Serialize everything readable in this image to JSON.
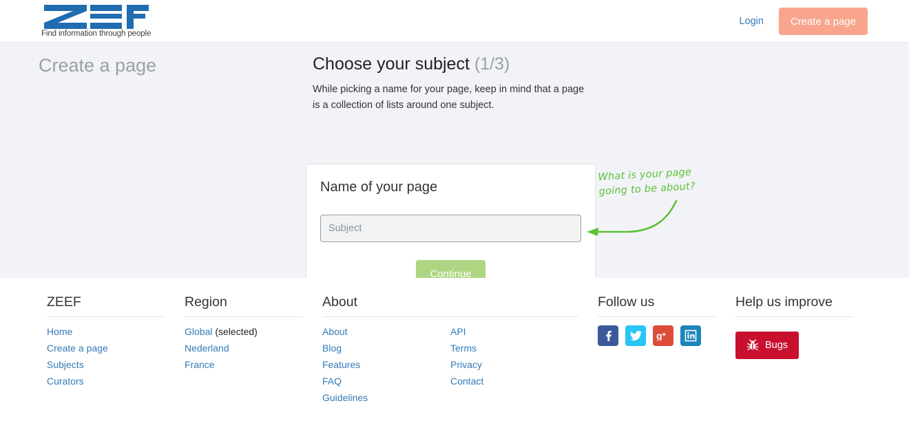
{
  "header": {
    "logo_text": "ZEEF",
    "logo_tagline": "Find information through people",
    "login_label": "Login",
    "create_page_label": "Create a page"
  },
  "content": {
    "page_title": "Create a page",
    "step_heading": "Choose your subject",
    "step_counter": "(1/3)",
    "step_description": "While picking a name for your page, keep in mind that a page is a collection of lists around one subject."
  },
  "form": {
    "card_label": "Name of your page",
    "subject_value": "",
    "subject_placeholder": "Subject",
    "continue_label": "Continue"
  },
  "annotation": {
    "text": "What is your page\ngoing to be about?",
    "color": "#5cc235"
  },
  "footer": {
    "columns": [
      {
        "heading": "ZEEF",
        "links": [
          "Home",
          "Create a page",
          "Subjects",
          "Curators"
        ]
      },
      {
        "heading": "Region",
        "links": [
          "Global",
          "Nederland",
          "France"
        ],
        "selected_suffix": "(selected)"
      },
      {
        "heading": "About",
        "links_left": [
          "About",
          "Blog",
          "Features",
          "FAQ",
          "Guidelines"
        ],
        "links_right": [
          "API",
          "Terms",
          "Privacy",
          "Contact"
        ]
      },
      {
        "heading": "Follow us",
        "socials": [
          {
            "name": "facebook-icon",
            "glyph": "f",
            "color": "#3b5998"
          },
          {
            "name": "twitter-icon",
            "glyph": "ᵗ",
            "color": "#29c5f6"
          },
          {
            "name": "google-plus-icon",
            "glyph": "g⁺",
            "color": "#dd4b39"
          },
          {
            "name": "linkedin-icon",
            "glyph": "in",
            "color": "#1b86bc"
          }
        ]
      },
      {
        "heading": "Help us improve",
        "bugs_label": "Bugs",
        "bugs_color": "#c8102e"
      }
    ]
  },
  "colors": {
    "brand_blue": "#1f6cb0",
    "link_blue": "#337ab7",
    "accent_salmon": "#f9a58e",
    "accent_green": "#aed581",
    "band_gray": "#f2f3f7"
  }
}
